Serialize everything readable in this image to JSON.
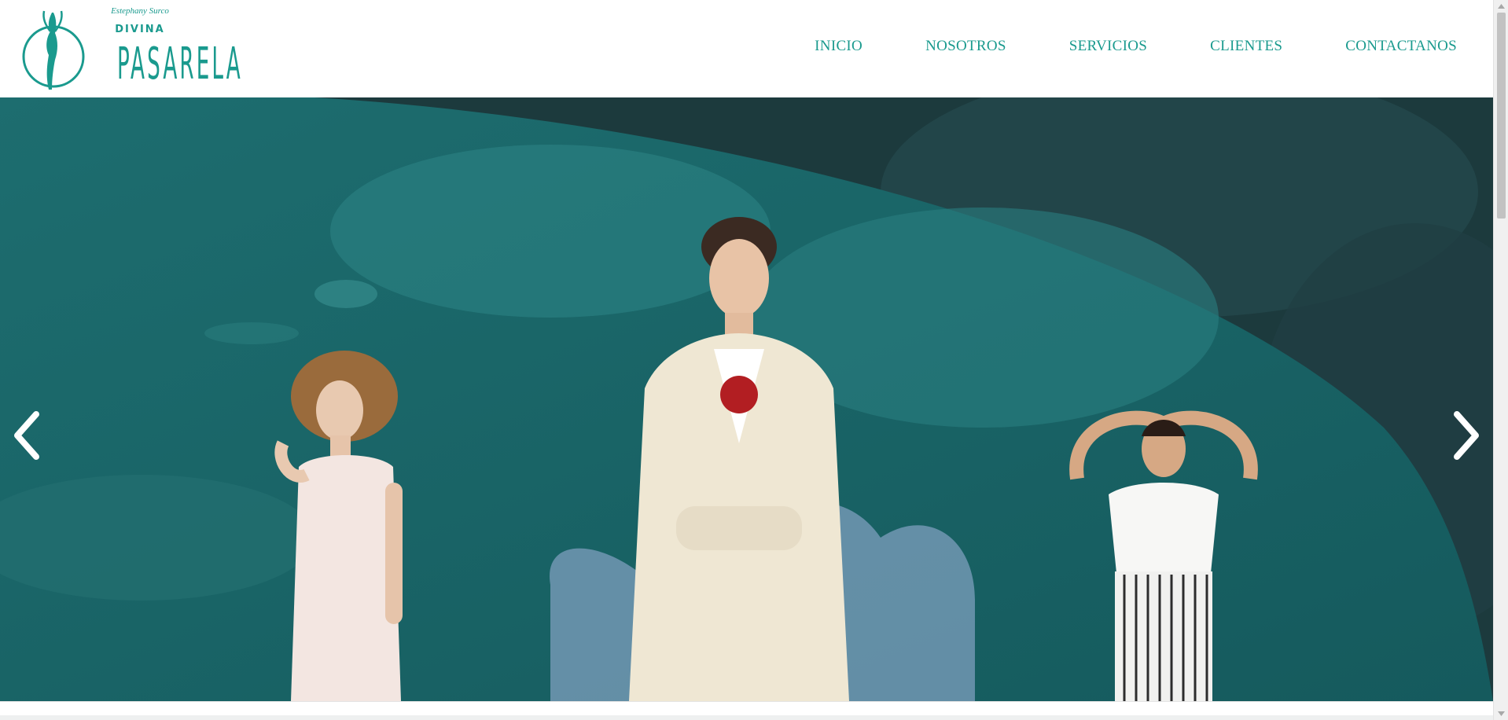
{
  "brand": {
    "tagline": "Estephany Surco",
    "line1": "DIVINA",
    "line2": "PASARELA"
  },
  "nav": {
    "items": [
      {
        "label": "INICIO"
      },
      {
        "label": "NOSOTROS"
      },
      {
        "label": "SERVICIOS"
      },
      {
        "label": "CLIENTES"
      },
      {
        "label": "CONTACTANOS"
      }
    ]
  },
  "hero": {
    "prev_icon": "chevron-left-icon",
    "next_icon": "chevron-right-icon"
  },
  "colors": {
    "brand": "#1a9a8e",
    "hero_teal": "#1c6b6d",
    "hero_dark": "#1c3a3d",
    "white": "#ffffff"
  }
}
